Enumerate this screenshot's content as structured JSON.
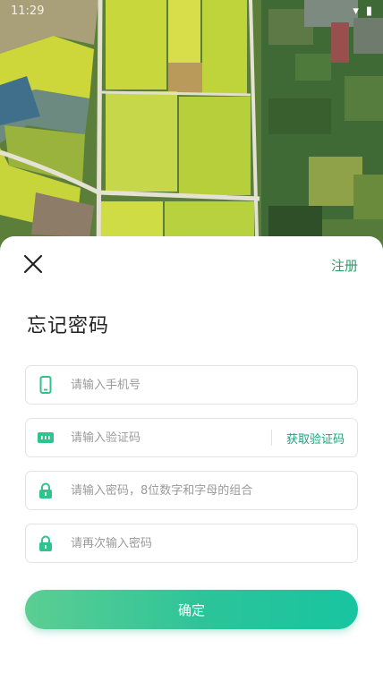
{
  "status_bar": {
    "time": "11:29"
  },
  "header": {
    "register_label": "注册",
    "title": "忘记密码"
  },
  "form": {
    "phone": {
      "placeholder": "请输入手机号",
      "value": "",
      "icon": "phone-icon"
    },
    "code": {
      "placeholder": "请输入验证码",
      "value": "",
      "icon": "sms-code-icon",
      "get_code_label": "获取验证码"
    },
    "password": {
      "placeholder": "请输入密码，8位数字和字母的组合",
      "value": "",
      "icon": "lock-icon"
    },
    "password_confirm": {
      "placeholder": "请再次输入密码",
      "value": "",
      "icon": "lock-icon"
    }
  },
  "confirm_label": "确定",
  "colors": {
    "accent": "#2a9d6a",
    "button_gradient_start": "#5cce92",
    "button_gradient_end": "#17c5a0",
    "icon": "#2fc48d"
  }
}
